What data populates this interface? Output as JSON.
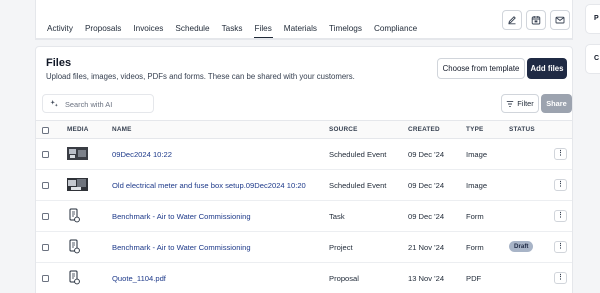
{
  "tabs": [
    {
      "label": "Activity",
      "active": false
    },
    {
      "label": "Proposals",
      "active": false
    },
    {
      "label": "Invoices",
      "active": false
    },
    {
      "label": "Schedule",
      "active": false
    },
    {
      "label": "Tasks",
      "active": false
    },
    {
      "label": "Files",
      "active": true
    },
    {
      "label": "Materials",
      "active": false
    },
    {
      "label": "Timelogs",
      "active": false
    },
    {
      "label": "Compliance",
      "active": false
    }
  ],
  "header_icons": [
    "pencil-icon",
    "calendar-icon",
    "mail-icon"
  ],
  "right_panel": {
    "labels": [
      "P",
      "C"
    ]
  },
  "files": {
    "title": "Files",
    "subtitle": "Upload files, images, videos, PDFs and forms. These can be shared with your customers.",
    "choose_template_label": "Choose from template",
    "add_files_label": "Add files",
    "search_placeholder": "Search with AI",
    "filter_label": "Filter",
    "share_label": "Share",
    "columns": {
      "media": "MEDIA",
      "name": "NAME",
      "source": "SOURCE",
      "created": "CREATED",
      "type": "TYPE",
      "status": "STATUS"
    },
    "rows": [
      {
        "media": "image-thumbnail",
        "name": "09Dec2024 10:22",
        "source": "Scheduled Event",
        "created": "09 Dec '24",
        "type": "Image",
        "status": "",
        "kebab": "⋮"
      },
      {
        "media": "image-thumbnail",
        "name": "Old electrical meter and fuse box setup.09Dec2024 10:20",
        "source": "Scheduled Event",
        "created": "09 Dec '24",
        "type": "Image",
        "status": "",
        "kebab": "⋮"
      },
      {
        "media": "form-icon",
        "name": "Benchmark - Air to Water Commissioning",
        "source": "Task",
        "created": "09 Dec '24",
        "type": "Form",
        "status": "",
        "kebab": "⋮"
      },
      {
        "media": "form-icon",
        "name": "Benchmark - Air to Water Commissioning",
        "source": "Project",
        "created": "21 Nov '24",
        "type": "Form",
        "status": "Draft",
        "kebab": "⋮"
      },
      {
        "media": "form-icon",
        "name": "Quote_1104.pdf",
        "source": "Proposal",
        "created": "13 Nov '24",
        "type": "PDF",
        "status": "",
        "kebab": "⋮"
      }
    ]
  },
  "colors": {
    "primary_button": "#1f2a44",
    "link": "#1e3a8a",
    "draft_badge": "#a8b4c7",
    "share_disabled": "#9ca3af"
  }
}
